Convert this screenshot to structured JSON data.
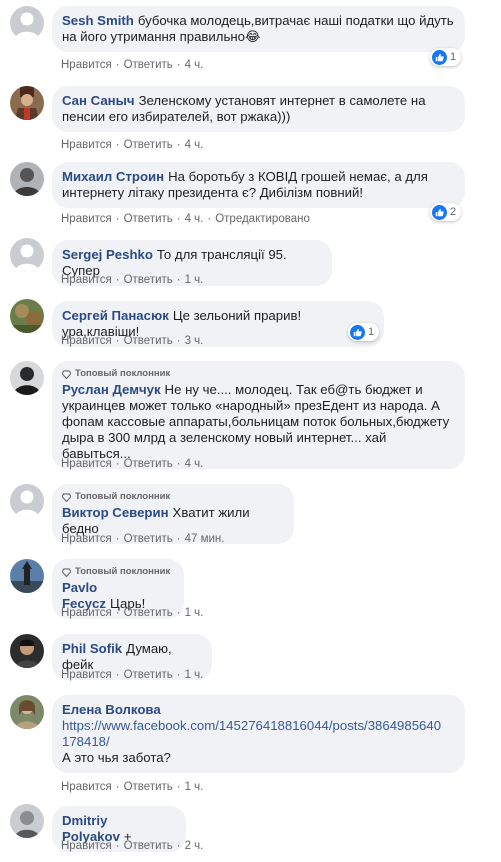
{
  "fan_badge_label": "Топовый поклонник",
  "like_label": "Нравится",
  "reply_label": "Ответить",
  "comments": [
    {
      "author": "Sesh Smith",
      "text": "бубочка молодець,витрачає наші податки що йдуть на його утримання правильно😂",
      "time": "4 ч.",
      "likes": "1"
    },
    {
      "author": "Сан Саныч",
      "text": "Зеленскому установят интернет в самолете на пенсии его избирателей, вот ржака)))",
      "time": "4 ч."
    },
    {
      "author": "Михаил Строин",
      "text": "На боротьбу з КОВІД грошей немає, а для интернету літаку президента є? Дибілізм повний!",
      "time": "4 ч.",
      "edited": "Отредактировано",
      "likes": "2"
    },
    {
      "author": "Sergej Peshko",
      "text": "То для трансляції 95. Супер",
      "time": "1 ч."
    },
    {
      "author": "Сергей Панасюк",
      "text": "Це зельоний прарив!ура,клавіши!",
      "time": "3 ч.",
      "likes": "1"
    },
    {
      "author": "Руслан Демчук",
      "text": "Не ну че.... молодец. Так еб@ть бюджет и украинцев может только «народный» презЕдент из народа. А фопам кассовые аппараты,больницам поток больных,бюджету дыра в 300 млрд а зеленскому новый интернет... хай бавыться...",
      "time": "4 ч.",
      "top_fan": true
    },
    {
      "author": "Виктор Северин",
      "text": "Хватит жили бедно",
      "time": "47 мин.",
      "top_fan": true
    },
    {
      "author": "Pavlo Fecycz",
      "text": "Царь!",
      "time": "1 ч.",
      "top_fan": true
    },
    {
      "author": "Phil Sofik",
      "text": "Думаю, фейк",
      "time": "1 ч."
    },
    {
      "author": "Елена Волкова",
      "link": "https://www.facebook.com/145276418816044/posts/3864985640178418/",
      "text2": "А это чья забота?",
      "time": "1 ч."
    },
    {
      "author": "Dmitriy Polyakov",
      "text": "+",
      "time": "2 ч."
    }
  ],
  "colors": {
    "author": "#2b4a84",
    "bubble": "#f0f2f5",
    "meta": "#65676b",
    "like_blue": "#1877f2"
  }
}
